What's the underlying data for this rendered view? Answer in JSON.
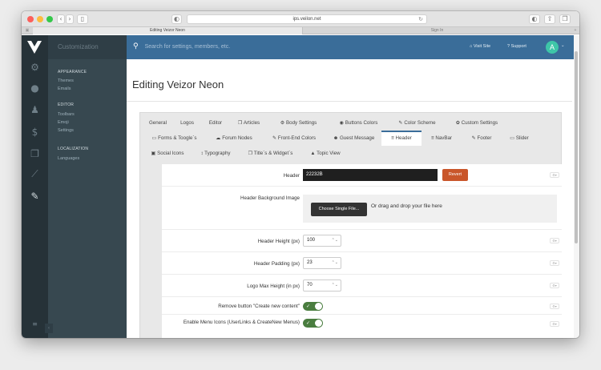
{
  "browser": {
    "url": "ips.veilon.net",
    "tabs": [
      {
        "label": "Editing Veizor Neon",
        "active": true
      },
      {
        "label": "Sign In",
        "active": false
      }
    ]
  },
  "colors": {
    "accent": "#3a6d99",
    "rail": "#263238",
    "sidebar": "#374850",
    "revert": "#c9562a",
    "toggle_on": "#4a7d3f"
  },
  "sidebar": {
    "brand": "Customization",
    "sections": [
      {
        "heading": "APPEARANCE",
        "items": [
          "Themes",
          "Emails"
        ]
      },
      {
        "heading": "EDITOR",
        "items": [
          "Toolbars",
          "Emoji",
          "Settings"
        ]
      },
      {
        "heading": "LOCALIZATION",
        "items": [
          "Languages"
        ]
      }
    ],
    "rail_icons": [
      "cogs-icon",
      "chat-icon",
      "user-icon",
      "dollar-icon",
      "copy-icon",
      "chart-icon",
      "brush-icon"
    ]
  },
  "topbar": {
    "search_placeholder": "Search for settings, members, etc.",
    "visit_site": "Visit Site",
    "support": "Support",
    "avatar_letter": "A"
  },
  "page": {
    "title": "Editing Veizor Neon"
  },
  "tabs": [
    {
      "label": "General"
    },
    {
      "label": "Logos"
    },
    {
      "label": "Editor"
    },
    {
      "label": "Articles",
      "icon": "❐"
    },
    {
      "label": "Body Settings",
      "icon": "⚙"
    },
    {
      "label": "Buttons Colors",
      "icon": "◉"
    },
    {
      "label": "Color Scheme",
      "icon": "✎"
    },
    {
      "label": "Custom Settings",
      "icon": "✿"
    },
    {
      "label": "Forms & Toogle`s",
      "icon": "▭"
    },
    {
      "label": "Forum Nodes",
      "icon": "☁"
    },
    {
      "label": "Front-End Colors",
      "icon": "✎"
    },
    {
      "label": "Guest Message",
      "icon": "☻"
    },
    {
      "label": "Header",
      "icon": "≡",
      "active": true
    },
    {
      "label": "NavBar",
      "icon": "≡"
    },
    {
      "label": "Footer",
      "icon": "✎"
    },
    {
      "label": "Slider",
      "icon": "▭"
    },
    {
      "label": "Social Icons",
      "icon": "▣"
    },
    {
      "label": "Typography",
      "icon": "↕"
    },
    {
      "label": "Title`s & Widget`s",
      "icon": "❐"
    },
    {
      "label": "Topic View",
      "icon": "▲"
    }
  ],
  "form": {
    "header": {
      "label": "Header",
      "value": "22232B",
      "revert": "Revert"
    },
    "bg_image": {
      "label": "Header Background Image",
      "button": "Choose Single File...",
      "hint": "Or drag and drop your file here"
    },
    "header_height": {
      "label": "Header Height (px)",
      "value": "100"
    },
    "header_padding": {
      "label": "Header Padding (px)",
      "value": "23"
    },
    "logo_max_height": {
      "label": "Logo Max Height (in px)",
      "value": "70"
    },
    "remove_button": {
      "label": "Remove button \"Create new content\"",
      "on": true
    },
    "menu_icons": {
      "label": "Enable Menu Icons (UserLinks & CreateNew Menus)",
      "on": true
    }
  }
}
